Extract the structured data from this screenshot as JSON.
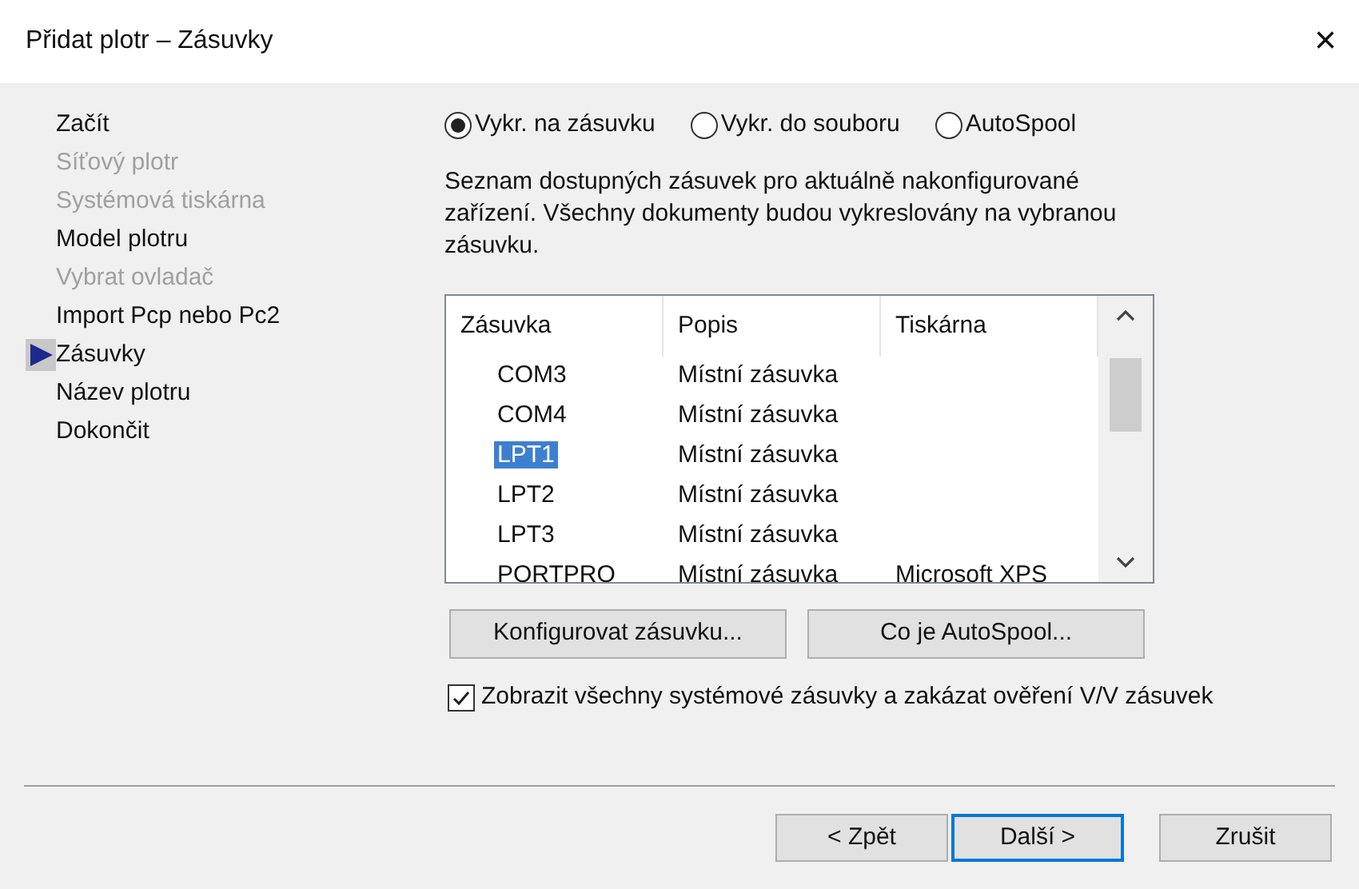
{
  "window": {
    "title": "Přidat plotr – Zásuvky",
    "close": "×"
  },
  "sidebar": {
    "items": [
      {
        "label": "Začít",
        "disabled": false,
        "selected": false
      },
      {
        "label": "Síťový plotr",
        "disabled": true,
        "selected": false
      },
      {
        "label": "Systémová tiskárna",
        "disabled": true,
        "selected": false
      },
      {
        "label": "Model plotru",
        "disabled": false,
        "selected": false
      },
      {
        "label": "Vybrat ovladač",
        "disabled": true,
        "selected": false
      },
      {
        "label": "Import Pcp nebo Pc2",
        "disabled": false,
        "selected": false
      },
      {
        "label": "Zásuvky",
        "disabled": false,
        "selected": true
      },
      {
        "label": "Název plotru",
        "disabled": false,
        "selected": false
      },
      {
        "label": "Dokončit",
        "disabled": false,
        "selected": false
      }
    ]
  },
  "radios": [
    {
      "label": "Vykr. na zásuvku",
      "selected": true
    },
    {
      "label": "Vykr. do souboru",
      "selected": false
    },
    {
      "label": "AutoSpool",
      "selected": false
    }
  ],
  "description": "Seznam dostupných zásuvek pro aktuálně nakonfigurované zařízení. Všechny dokumenty budou vykreslovány na vybranou zásuvku.",
  "table": {
    "columns": [
      "Zásuvka",
      "Popis",
      "Tiskárna"
    ],
    "rows": [
      {
        "cells": [
          "COM3",
          "Místní zásuvka",
          ""
        ],
        "selected": false
      },
      {
        "cells": [
          "COM4",
          "Místní zásuvka",
          ""
        ],
        "selected": false
      },
      {
        "cells": [
          "LPT1",
          "Místní zásuvka",
          ""
        ],
        "selected": true
      },
      {
        "cells": [
          "LPT2",
          "Místní zásuvka",
          ""
        ],
        "selected": false
      },
      {
        "cells": [
          "LPT3",
          "Místní zásuvka",
          ""
        ],
        "selected": false
      },
      {
        "cells": [
          "PORTPRO",
          "Místní zásuvka",
          "Microsoft XPS"
        ],
        "selected": false
      }
    ]
  },
  "buttons": [
    "Konfigurovat zásuvku...",
    "Co je AutoSpool..."
  ],
  "checkbox": {
    "label": "Zobrazit všechny systémové zásuvky a zakázat ověření V/V zásuvek",
    "checked": true
  },
  "footer": [
    {
      "label": "< Zpět",
      "focused": false
    },
    {
      "label": "Další >",
      "focused": true
    },
    {
      "label": "Zrušit",
      "focused": false
    }
  ]
}
